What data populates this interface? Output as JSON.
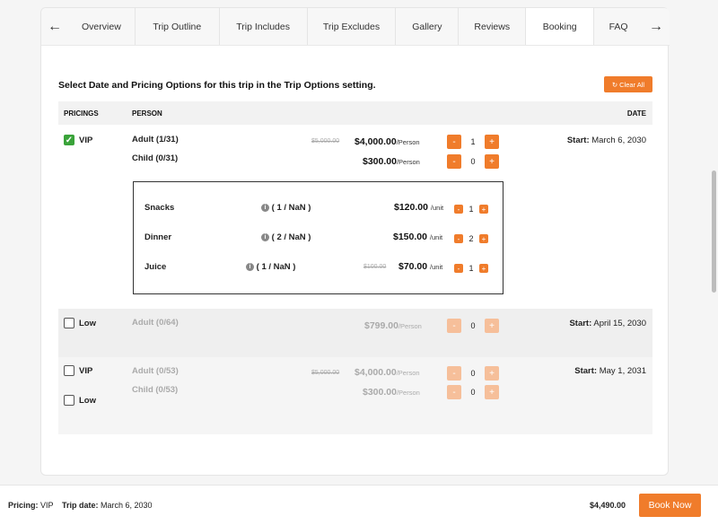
{
  "tabs": [
    "Overview",
    "Trip Outline",
    "Trip Includes",
    "Trip Excludes",
    "Gallery",
    "Reviews",
    "Booking",
    "FAQ"
  ],
  "active_tab": "Booking",
  "heading": "Select Date and Pricing Options for this trip in the Trip Options setting.",
  "clear_all": "Clear All",
  "table_headers": {
    "pricings": "PRICINGS",
    "person": "PERSON",
    "date": "DATE"
  },
  "rows": [
    {
      "pricing": "VIP",
      "checked": true,
      "persons": [
        {
          "label": "Adult",
          "count": "(1/31)",
          "old_price": "$5,000.00",
          "price": "$4,000.00",
          "unit": "/Person",
          "qty": "1"
        },
        {
          "label": "Child",
          "count": "(0/31)",
          "price": "$300.00",
          "unit": "/Person",
          "qty": "0"
        }
      ],
      "date_label": "Start:",
      "date": "March 6, 2030",
      "extras": [
        {
          "label": "Snacks",
          "count": "( 1 / NaN )",
          "price": "$120.00",
          "unit": "/unit",
          "qty": "1"
        },
        {
          "label": "Dinner",
          "count": "( 2 / NaN )",
          "price": "$150.00",
          "unit": "/unit",
          "qty": "2"
        },
        {
          "label": "Juice",
          "count": "( 1 / NaN )",
          "old_price": "$100.00",
          "price": "$70.00",
          "unit": "/unit",
          "qty": "1"
        }
      ]
    },
    {
      "pricing": "Low",
      "checked": false,
      "persons": [
        {
          "label": "Adult",
          "count": "(0/64)",
          "price": "$799.00",
          "unit": "/Person",
          "qty": "0"
        }
      ],
      "date_label": "Start:",
      "date": "April 15, 2030"
    },
    {
      "pricings": [
        "VIP",
        "Low"
      ],
      "checked": false,
      "persons": [
        {
          "label": "Adult",
          "count": "(0/53)",
          "old_price": "$5,000.00",
          "price": "$4,000.00",
          "unit": "/Person",
          "qty": "0"
        },
        {
          "label": "Child",
          "count": "(0/53)",
          "price": "$300.00",
          "unit": "/Person",
          "qty": "0"
        }
      ],
      "date_label": "Start:",
      "date": "May 1, 2031"
    }
  ],
  "footer": {
    "pricing_label": "Pricing:",
    "pricing_value": "VIP",
    "trip_date_label": "Trip date:",
    "trip_date_value": "March 6, 2030",
    "total": "$4,490.00",
    "book_now": "Book Now"
  },
  "icons": {
    "left": "arrow-left-icon",
    "right": "arrow-right-icon",
    "info": "info-icon",
    "check": "check-icon"
  },
  "colors": {
    "accent": "#f07c2b",
    "accent_faded": "#f6bf9a",
    "check": "#3aa33a"
  }
}
